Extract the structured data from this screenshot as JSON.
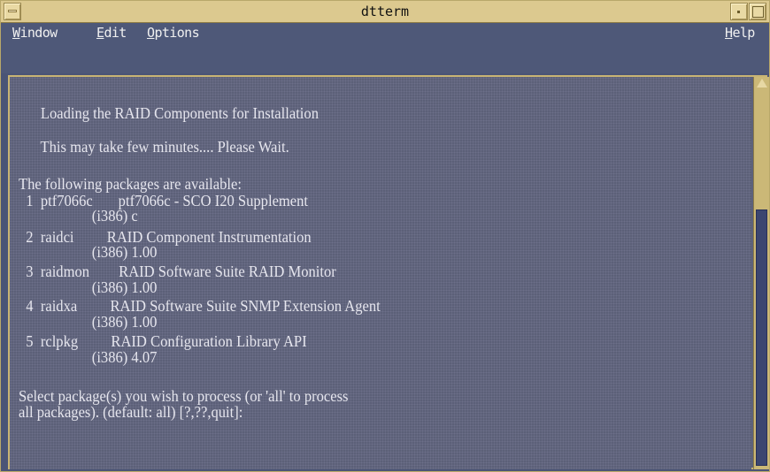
{
  "window": {
    "title": "dtterm"
  },
  "menubar": {
    "window": {
      "mnemonic": "W",
      "rest": "indow"
    },
    "edit": {
      "mnemonic": "E",
      "rest": "dit"
    },
    "options": {
      "mnemonic": "O",
      "rest": "ptions"
    },
    "help": {
      "mnemonic": "H",
      "rest": "elp"
    }
  },
  "terminal": {
    "lines": [
      "      Loading the RAID Components for Installation",
      "      This may take few minutes.... Please Wait.",
      "The following packages are available:",
      "  1  ptf7066c       ptf7066c - SCO I20 Supplement",
      "                    (i386) c",
      "  2  raidci         RAID Component Instrumentation",
      "                    (i386) 1.00",
      "  3  raidmon        RAID Software Suite RAID Monitor",
      "                    (i386) 1.00",
      "  4  raidxa         RAID Software Suite SNMP Extension Agent",
      "                    (i386) 1.00",
      "  5  rclpkg         RAID Configuration Library API",
      "                    (i386) 4.07",
      "Select package(s) you wish to process (or 'all' to process",
      "all packages). (default: all) [?,??,quit]:"
    ]
  },
  "colors": {
    "titlebar": "#dcc98f",
    "terminal_bg": "#5c6078",
    "terminal_fg": "#e6e6ee",
    "scroll_thumb": "#3c4670"
  }
}
